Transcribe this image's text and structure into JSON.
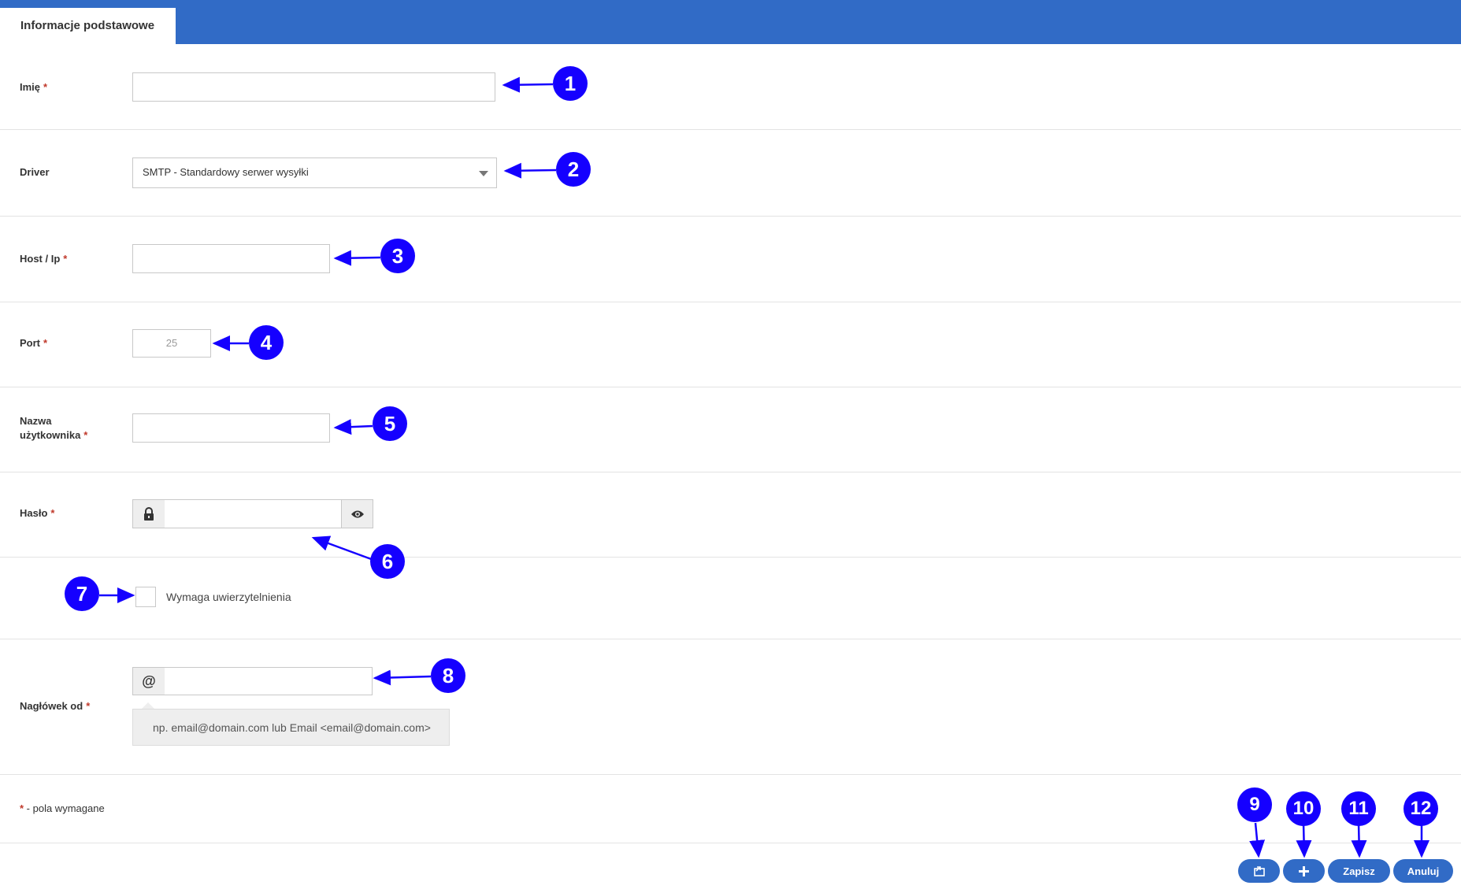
{
  "header": {
    "active_tab": "Informacje podstawowe",
    "accent": "#316bc6"
  },
  "form": {
    "name": {
      "label": "Imię",
      "required": "*",
      "value": ""
    },
    "driver": {
      "label": "Driver",
      "selected": "SMTP - Standardowy serwer wysyłki"
    },
    "host": {
      "label": "Host / Ip",
      "required": "*",
      "value": ""
    },
    "port": {
      "label": "Port",
      "required": "*",
      "placeholder": "25"
    },
    "username": {
      "label_line1": "Nazwa",
      "label_line2": "użytkownika",
      "required": "*",
      "value": ""
    },
    "password": {
      "label": "Hasło",
      "required": "*",
      "value": "",
      "lock_icon": "lock-icon",
      "eye_icon": "eye-icon"
    },
    "auth": {
      "label": "Wymaga uwierzytelnienia",
      "checked": false
    },
    "from_header": {
      "label": "Nagłówek od",
      "required": "*",
      "addon": "@",
      "value": "",
      "hint": "np. email@domain.com lub Email <email@domain.com>"
    }
  },
  "footnote": {
    "star": "*",
    "text": " - pola wymagane"
  },
  "buttons": {
    "save": "Zapisz",
    "cancel": "Anuluj",
    "add_icon": "plus-icon",
    "export_icon": "export-icon"
  },
  "callouts": [
    "1",
    "2",
    "3",
    "4",
    "5",
    "6",
    "7",
    "8",
    "9",
    "10",
    "11",
    "12"
  ],
  "callout_color": "#1500ff"
}
